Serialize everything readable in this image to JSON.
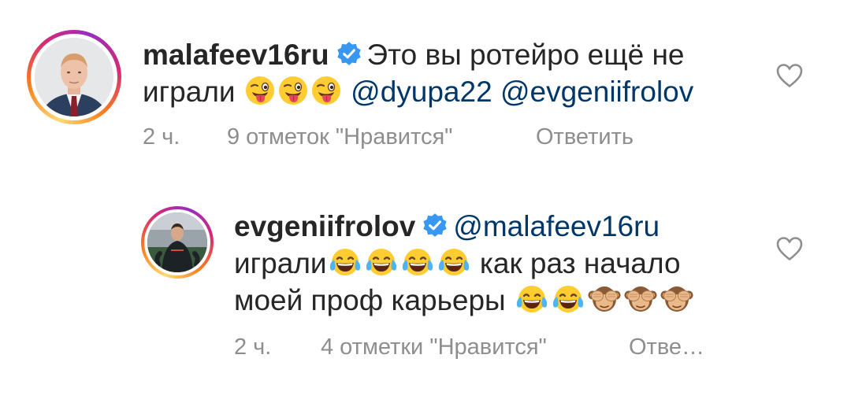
{
  "comments": [
    {
      "username": "malafeev16ru",
      "verified": true,
      "text_line1": "Это вы ротейро ещё не",
      "text_line2_prefix": "играли",
      "emojis": [
        "tongue-wink",
        "tongue-wink",
        "tongue-wink"
      ],
      "mentions": [
        "@dyupa22",
        "@evgeniifrolov"
      ],
      "time": "2 ч.",
      "likes": "9 отметок \"Нравится\"",
      "reply": "Ответить"
    },
    {
      "username": "evgeniifrolov",
      "verified": true,
      "mention": "@malafeev16ru",
      "text_word1": "играли",
      "laugh_emojis_1": [
        "tears-of-joy",
        "tears-of-joy",
        "tears-of-joy",
        "tears-of-joy"
      ],
      "text_after": "как раз начало",
      "text_line3": "моей проф карьеры",
      "laugh_emojis_2": [
        "tears-of-joy",
        "tears-of-joy"
      ],
      "monkey_emojis": [
        "see-no-evil",
        "see-no-evil",
        "see-no-evil"
      ],
      "time": "2 ч.",
      "likes": "4 отметки \"Нравится\"",
      "reply": "Отве…"
    }
  ],
  "colors": {
    "text": "#262626",
    "meta": "#8e8e8e",
    "mention": "#00376b",
    "verified": "#3897f0"
  }
}
